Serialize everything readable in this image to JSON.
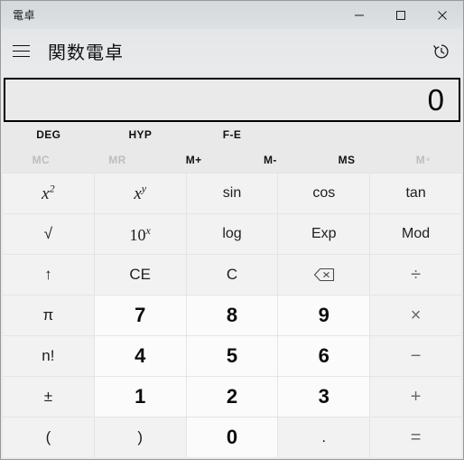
{
  "window": {
    "title": "電卓",
    "caption_buttons": [
      {
        "name": "minimize",
        "glyph": "minimize-icon"
      },
      {
        "name": "maximize",
        "glyph": "maximize-icon"
      },
      {
        "name": "close",
        "glyph": "close-icon"
      }
    ]
  },
  "header": {
    "menu_icon": "hamburger-menu-icon",
    "app_title": "関数電卓",
    "history_icon": "history-clock-icon"
  },
  "display": {
    "value": "0"
  },
  "modes": [
    {
      "label": "DEG",
      "disabled": false
    },
    {
      "label": "HYP",
      "disabled": false
    },
    {
      "label": "F-E",
      "disabled": false
    },
    {
      "label": "",
      "disabled": false
    },
    {
      "label": "",
      "disabled": false
    }
  ],
  "memory": [
    {
      "label": "MC",
      "disabled": true
    },
    {
      "label": "MR",
      "disabled": true
    },
    {
      "label": "M+",
      "disabled": false
    },
    {
      "label": "M-",
      "disabled": false
    },
    {
      "label": "MS",
      "disabled": false
    },
    {
      "label": "M",
      "disabled": true,
      "chevron": "˅"
    }
  ],
  "keypad": {
    "rows": [
      [
        {
          "id": "square",
          "label": "x²",
          "html": "<span class='mathital'>x<sup>2</sup></span>",
          "type": "func"
        },
        {
          "id": "power",
          "label": "xʸ",
          "html": "<span class='mathital'>x<sup>y</sup></span>",
          "type": "func"
        },
        {
          "id": "sin",
          "label": "sin",
          "type": "func"
        },
        {
          "id": "cos",
          "label": "cos",
          "type": "func"
        },
        {
          "id": "tan",
          "label": "tan",
          "type": "func"
        }
      ],
      [
        {
          "id": "sqrt",
          "label": "√",
          "type": "func"
        },
        {
          "id": "ten-power-x",
          "label": "10ˣ",
          "html": "<span class='mathupright'>10<sup>x</sup></span>",
          "type": "func"
        },
        {
          "id": "log",
          "label": "log",
          "type": "func"
        },
        {
          "id": "exp",
          "label": "Exp",
          "type": "func"
        },
        {
          "id": "mod",
          "label": "Mod",
          "type": "func"
        }
      ],
      [
        {
          "id": "shift-up",
          "label": "↑",
          "type": "func"
        },
        {
          "id": "clear-entry",
          "label": "CE",
          "type": "func"
        },
        {
          "id": "clear",
          "label": "C",
          "type": "func"
        },
        {
          "id": "backspace",
          "label": "⌫",
          "type": "func",
          "icon": "backspace-icon"
        },
        {
          "id": "divide",
          "label": "÷",
          "type": "op"
        }
      ],
      [
        {
          "id": "pi",
          "label": "π",
          "type": "func"
        },
        {
          "id": "seven",
          "label": "7",
          "type": "num"
        },
        {
          "id": "eight",
          "label": "8",
          "type": "num"
        },
        {
          "id": "nine",
          "label": "9",
          "type": "num"
        },
        {
          "id": "multiply",
          "label": "×",
          "type": "op"
        }
      ],
      [
        {
          "id": "factorial",
          "label": "n!",
          "type": "func"
        },
        {
          "id": "four",
          "label": "4",
          "type": "num"
        },
        {
          "id": "five",
          "label": "5",
          "type": "num"
        },
        {
          "id": "six",
          "label": "6",
          "type": "num"
        },
        {
          "id": "subtract",
          "label": "−",
          "type": "op"
        }
      ],
      [
        {
          "id": "plus-minus",
          "label": "±",
          "type": "func"
        },
        {
          "id": "one",
          "label": "1",
          "type": "num"
        },
        {
          "id": "two",
          "label": "2",
          "type": "num"
        },
        {
          "id": "three",
          "label": "3",
          "type": "num"
        },
        {
          "id": "add",
          "label": "+",
          "type": "op"
        }
      ],
      [
        {
          "id": "paren-open",
          "label": "(",
          "type": "func"
        },
        {
          "id": "paren-close",
          "label": ")",
          "type": "func"
        },
        {
          "id": "zero",
          "label": "0",
          "type": "num"
        },
        {
          "id": "decimal",
          "label": ".",
          "type": "func"
        },
        {
          "id": "equals",
          "label": "=",
          "type": "op"
        }
      ]
    ]
  },
  "colors": {
    "window_bg": "#e9e9e9",
    "titlebar_bg": "#d9dde0",
    "key_func_bg": "#f2f2f2",
    "key_num_bg": "#fbfbfb",
    "display_border": "#000000",
    "disabled_text": "#bdbdbd"
  }
}
